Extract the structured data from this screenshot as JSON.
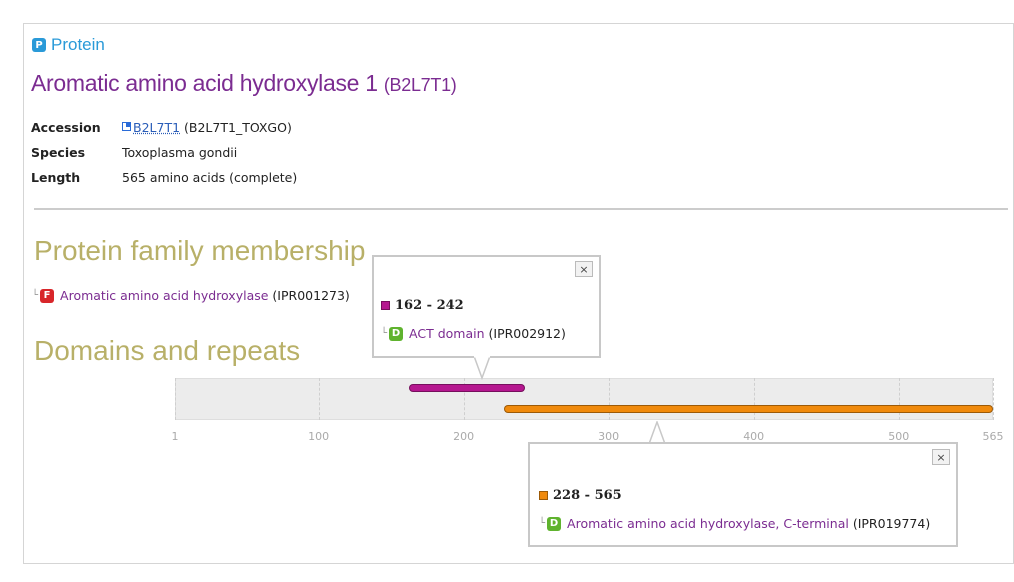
{
  "header": {
    "badge_letter": "P",
    "section_label": "Protein",
    "protein_name": "Aromatic amino acid hydroxylase 1",
    "protein_accession": "(B2L7T1)"
  },
  "details": {
    "accession_label": "Accession",
    "accession_link": "B2L7T1",
    "accession_id": "(B2L7T1_TOXGO)",
    "species_label": "Species",
    "species_value": "Toxoplasma gondii",
    "length_label": "Length",
    "length_value": "565 amino acids (complete)"
  },
  "family": {
    "heading": "Protein family membership",
    "badge_letter": "F",
    "name": "Aromatic amino acid hydroxylase",
    "id": "(IPR001273)"
  },
  "domains": {
    "heading": "Domains and repeats",
    "length": 565,
    "axis_ticks": [
      "1",
      "100",
      "200",
      "300",
      "400",
      "500",
      "565"
    ],
    "axis_tick_values": [
      1,
      100,
      200,
      300,
      400,
      500,
      565
    ],
    "items": [
      {
        "start": 162,
        "end": 242,
        "color": "#b5178f",
        "range_label": "162 - 242",
        "badge_letter": "D",
        "name": "ACT domain",
        "id": "(IPR002912)"
      },
      {
        "start": 228,
        "end": 565,
        "color": "#f08a0c",
        "range_label": "228 - 565",
        "badge_letter": "D",
        "name": "Aromatic amino acid hydroxylase, C-terminal",
        "id": "(IPR019774)"
      }
    ],
    "close_symbol": "×"
  }
}
